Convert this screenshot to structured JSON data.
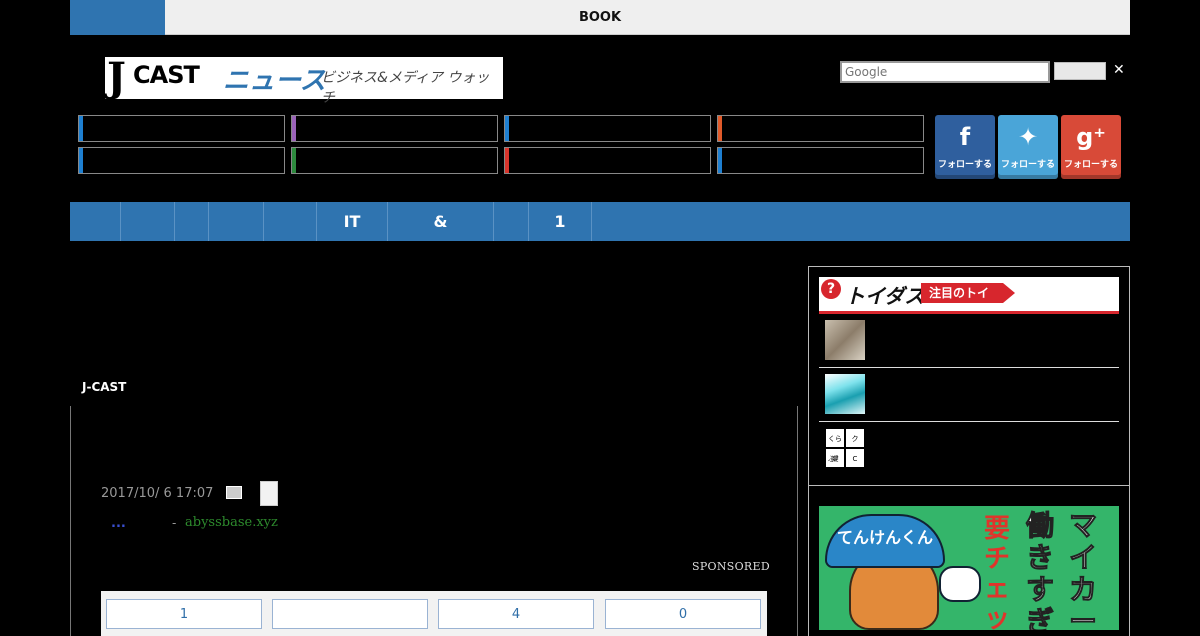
{
  "topbar": {
    "label": "BOOK"
  },
  "logo": {
    "mark": "J",
    "cast": "CAST",
    "news": "ニュース",
    "tagline": "ビジネス&メディア ウォッチ"
  },
  "search": {
    "placeholder": "Google"
  },
  "close_glyph": "✕",
  "categories": [
    {
      "color": "#1e7fd0"
    },
    {
      "color": "#9a62b8"
    },
    {
      "color": "#1e7fd0"
    },
    {
      "color": "#e05a2a"
    },
    {
      "color": "#1e7fd0"
    },
    {
      "color": "#2d8a3e"
    },
    {
      "color": "#d7342b"
    },
    {
      "color": "#1e7fd0"
    }
  ],
  "social": [
    {
      "icon": "f",
      "label": "フォローする",
      "color": "#2f5f9e",
      "name": "facebook-follow"
    },
    {
      "icon": "✦",
      "label": "フォローする",
      "color": "#4aa5d8",
      "name": "twitter-follow"
    },
    {
      "icon": "g⁺",
      "label": "フォローする",
      "color": "#d84a38",
      "name": "googleplus-follow"
    }
  ],
  "nav": {
    "items": [
      "",
      "",
      "",
      "",
      "",
      "IT",
      "&",
      "",
      "1"
    ]
  },
  "main": {
    "section_label": "J-CAST",
    "date": "2017/10/ 6 17:07",
    "ad_dots": "...",
    "ad_sep": "-",
    "ad_domain": "abyssbase.xyz",
    "sponsored": "SPONSORED",
    "share_counts": [
      "1",
      "",
      "4",
      "0"
    ]
  },
  "sidebar": {
    "toigus_mark": "?",
    "toigus_logo": "トイダス",
    "toigus_tag": "注目のトイ",
    "thumb3_cells": [
      "くらぶ？",
      "ク",
      "楽部？",
      "C"
    ]
  },
  "banner": {
    "cap_text": "てんけんくん",
    "col1": "要チェッ",
    "col2": "働きすぎ",
    "col3": "マイカー"
  }
}
